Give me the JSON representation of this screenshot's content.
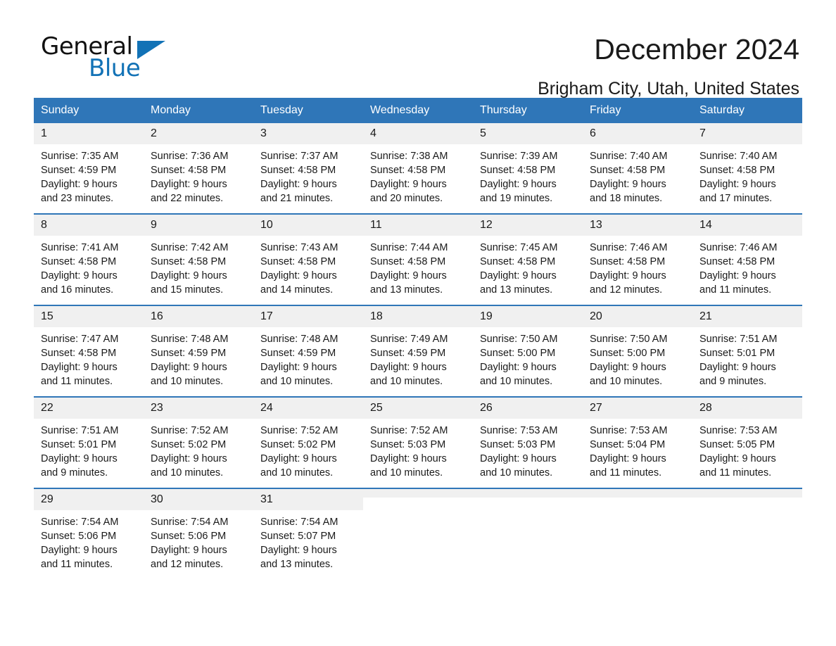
{
  "brand": {
    "word1": "General",
    "word2": "Blue",
    "accent_color": "#1272b6",
    "triangle_icon": "triangle-icon"
  },
  "header": {
    "month_title": "December 2024",
    "location": "Brigham City, Utah, United States"
  },
  "calendar": {
    "header_color": "#2f76b8",
    "daynum_band_color": "#f0f0f0",
    "weekdays": [
      "Sunday",
      "Monday",
      "Tuesday",
      "Wednesday",
      "Thursday",
      "Friday",
      "Saturday"
    ],
    "weeks": [
      [
        {
          "day": "1",
          "sunrise": "Sunrise: 7:35 AM",
          "sunset": "Sunset: 4:59 PM",
          "daylight1": "Daylight: 9 hours",
          "daylight2": "and 23 minutes."
        },
        {
          "day": "2",
          "sunrise": "Sunrise: 7:36 AM",
          "sunset": "Sunset: 4:58 PM",
          "daylight1": "Daylight: 9 hours",
          "daylight2": "and 22 minutes."
        },
        {
          "day": "3",
          "sunrise": "Sunrise: 7:37 AM",
          "sunset": "Sunset: 4:58 PM",
          "daylight1": "Daylight: 9 hours",
          "daylight2": "and 21 minutes."
        },
        {
          "day": "4",
          "sunrise": "Sunrise: 7:38 AM",
          "sunset": "Sunset: 4:58 PM",
          "daylight1": "Daylight: 9 hours",
          "daylight2": "and 20 minutes."
        },
        {
          "day": "5",
          "sunrise": "Sunrise: 7:39 AM",
          "sunset": "Sunset: 4:58 PM",
          "daylight1": "Daylight: 9 hours",
          "daylight2": "and 19 minutes."
        },
        {
          "day": "6",
          "sunrise": "Sunrise: 7:40 AM",
          "sunset": "Sunset: 4:58 PM",
          "daylight1": "Daylight: 9 hours",
          "daylight2": "and 18 minutes."
        },
        {
          "day": "7",
          "sunrise": "Sunrise: 7:40 AM",
          "sunset": "Sunset: 4:58 PM",
          "daylight1": "Daylight: 9 hours",
          "daylight2": "and 17 minutes."
        }
      ],
      [
        {
          "day": "8",
          "sunrise": "Sunrise: 7:41 AM",
          "sunset": "Sunset: 4:58 PM",
          "daylight1": "Daylight: 9 hours",
          "daylight2": "and 16 minutes."
        },
        {
          "day": "9",
          "sunrise": "Sunrise: 7:42 AM",
          "sunset": "Sunset: 4:58 PM",
          "daylight1": "Daylight: 9 hours",
          "daylight2": "and 15 minutes."
        },
        {
          "day": "10",
          "sunrise": "Sunrise: 7:43 AM",
          "sunset": "Sunset: 4:58 PM",
          "daylight1": "Daylight: 9 hours",
          "daylight2": "and 14 minutes."
        },
        {
          "day": "11",
          "sunrise": "Sunrise: 7:44 AM",
          "sunset": "Sunset: 4:58 PM",
          "daylight1": "Daylight: 9 hours",
          "daylight2": "and 13 minutes."
        },
        {
          "day": "12",
          "sunrise": "Sunrise: 7:45 AM",
          "sunset": "Sunset: 4:58 PM",
          "daylight1": "Daylight: 9 hours",
          "daylight2": "and 13 minutes."
        },
        {
          "day": "13",
          "sunrise": "Sunrise: 7:46 AM",
          "sunset": "Sunset: 4:58 PM",
          "daylight1": "Daylight: 9 hours",
          "daylight2": "and 12 minutes."
        },
        {
          "day": "14",
          "sunrise": "Sunrise: 7:46 AM",
          "sunset": "Sunset: 4:58 PM",
          "daylight1": "Daylight: 9 hours",
          "daylight2": "and 11 minutes."
        }
      ],
      [
        {
          "day": "15",
          "sunrise": "Sunrise: 7:47 AM",
          "sunset": "Sunset: 4:58 PM",
          "daylight1": "Daylight: 9 hours",
          "daylight2": "and 11 minutes."
        },
        {
          "day": "16",
          "sunrise": "Sunrise: 7:48 AM",
          "sunset": "Sunset: 4:59 PM",
          "daylight1": "Daylight: 9 hours",
          "daylight2": "and 10 minutes."
        },
        {
          "day": "17",
          "sunrise": "Sunrise: 7:48 AM",
          "sunset": "Sunset: 4:59 PM",
          "daylight1": "Daylight: 9 hours",
          "daylight2": "and 10 minutes."
        },
        {
          "day": "18",
          "sunrise": "Sunrise: 7:49 AM",
          "sunset": "Sunset: 4:59 PM",
          "daylight1": "Daylight: 9 hours",
          "daylight2": "and 10 minutes."
        },
        {
          "day": "19",
          "sunrise": "Sunrise: 7:50 AM",
          "sunset": "Sunset: 5:00 PM",
          "daylight1": "Daylight: 9 hours",
          "daylight2": "and 10 minutes."
        },
        {
          "day": "20",
          "sunrise": "Sunrise: 7:50 AM",
          "sunset": "Sunset: 5:00 PM",
          "daylight1": "Daylight: 9 hours",
          "daylight2": "and 10 minutes."
        },
        {
          "day": "21",
          "sunrise": "Sunrise: 7:51 AM",
          "sunset": "Sunset: 5:01 PM",
          "daylight1": "Daylight: 9 hours",
          "daylight2": "and 9 minutes."
        }
      ],
      [
        {
          "day": "22",
          "sunrise": "Sunrise: 7:51 AM",
          "sunset": "Sunset: 5:01 PM",
          "daylight1": "Daylight: 9 hours",
          "daylight2": "and 9 minutes."
        },
        {
          "day": "23",
          "sunrise": "Sunrise: 7:52 AM",
          "sunset": "Sunset: 5:02 PM",
          "daylight1": "Daylight: 9 hours",
          "daylight2": "and 10 minutes."
        },
        {
          "day": "24",
          "sunrise": "Sunrise: 7:52 AM",
          "sunset": "Sunset: 5:02 PM",
          "daylight1": "Daylight: 9 hours",
          "daylight2": "and 10 minutes."
        },
        {
          "day": "25",
          "sunrise": "Sunrise: 7:52 AM",
          "sunset": "Sunset: 5:03 PM",
          "daylight1": "Daylight: 9 hours",
          "daylight2": "and 10 minutes."
        },
        {
          "day": "26",
          "sunrise": "Sunrise: 7:53 AM",
          "sunset": "Sunset: 5:03 PM",
          "daylight1": "Daylight: 9 hours",
          "daylight2": "and 10 minutes."
        },
        {
          "day": "27",
          "sunrise": "Sunrise: 7:53 AM",
          "sunset": "Sunset: 5:04 PM",
          "daylight1": "Daylight: 9 hours",
          "daylight2": "and 11 minutes."
        },
        {
          "day": "28",
          "sunrise": "Sunrise: 7:53 AM",
          "sunset": "Sunset: 5:05 PM",
          "daylight1": "Daylight: 9 hours",
          "daylight2": "and 11 minutes."
        }
      ],
      [
        {
          "day": "29",
          "sunrise": "Sunrise: 7:54 AM",
          "sunset": "Sunset: 5:06 PM",
          "daylight1": "Daylight: 9 hours",
          "daylight2": "and 11 minutes."
        },
        {
          "day": "30",
          "sunrise": "Sunrise: 7:54 AM",
          "sunset": "Sunset: 5:06 PM",
          "daylight1": "Daylight: 9 hours",
          "daylight2": "and 12 minutes."
        },
        {
          "day": "31",
          "sunrise": "Sunrise: 7:54 AM",
          "sunset": "Sunset: 5:07 PM",
          "daylight1": "Daylight: 9 hours",
          "daylight2": "and 13 minutes."
        },
        {
          "day": "",
          "sunrise": "",
          "sunset": "",
          "daylight1": "",
          "daylight2": ""
        },
        {
          "day": "",
          "sunrise": "",
          "sunset": "",
          "daylight1": "",
          "daylight2": ""
        },
        {
          "day": "",
          "sunrise": "",
          "sunset": "",
          "daylight1": "",
          "daylight2": ""
        },
        {
          "day": "",
          "sunrise": "",
          "sunset": "",
          "daylight1": "",
          "daylight2": ""
        }
      ]
    ]
  }
}
